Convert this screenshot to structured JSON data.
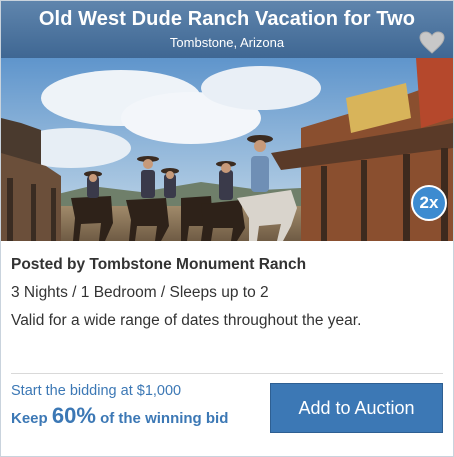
{
  "listing": {
    "title": "Old West Dude Ranch Vacation for Two",
    "location": "Tombstone, Arizona",
    "favorite_icon": "heart-icon",
    "multiplier_badge": "2x",
    "posted_by": "Posted by Tombstone Monument Ranch",
    "details": "3 Nights / 1 Bedroom / Sleeps up to 2",
    "validity": "Valid for a wide range of dates throughout the year."
  },
  "bidding": {
    "start_text": "Start the bidding at $1,000",
    "keep_prefix": "Keep ",
    "keep_percent": "60%",
    "keep_suffix": " of the winning bid"
  },
  "actions": {
    "add_to_auction": "Add to Auction"
  },
  "colors": {
    "header": "#4f77a2",
    "accent": "#3c78b5",
    "badge": "#3d8bd0"
  }
}
